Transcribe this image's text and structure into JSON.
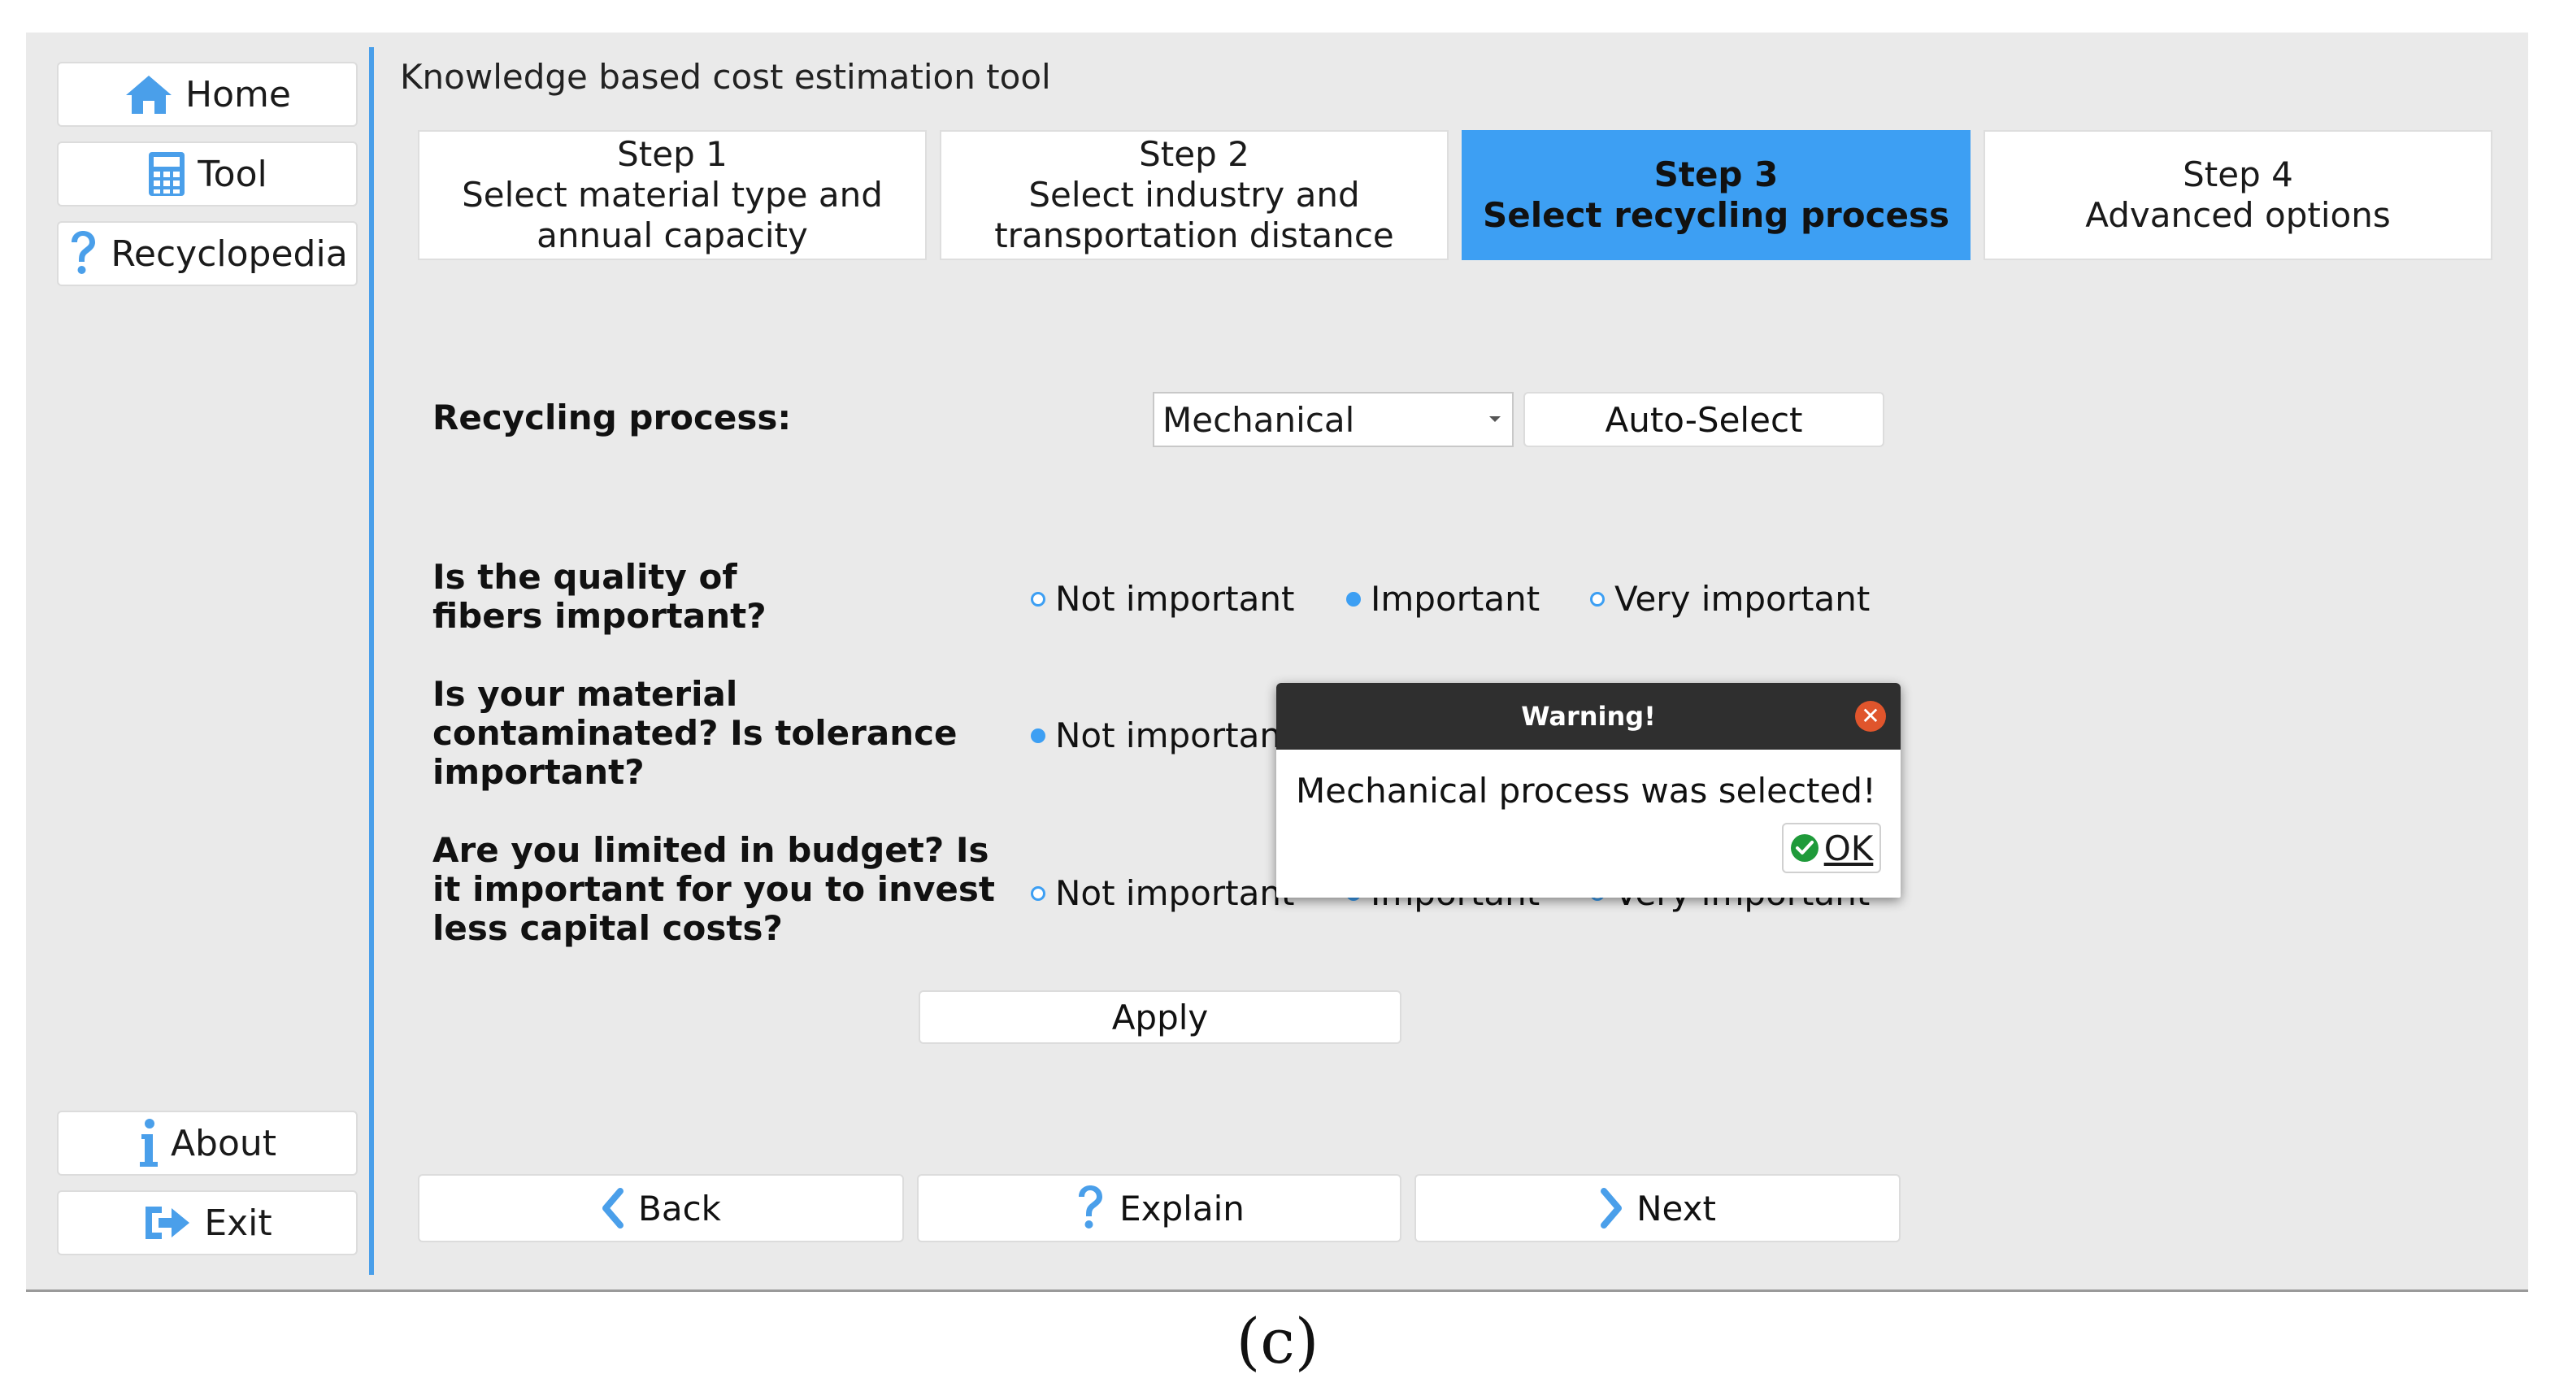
{
  "app": {
    "title": "Knowledge based cost estimation tool",
    "accent_color": "#3d9ff3"
  },
  "sidebar": {
    "items": [
      {
        "label": "Home",
        "icon": "home-icon"
      },
      {
        "label": "Tool",
        "icon": "calculator-icon"
      },
      {
        "label": "Recyclopedia",
        "icon": "question-icon"
      },
      {
        "label": "About",
        "icon": "info-icon"
      },
      {
        "label": "Exit",
        "icon": "exit-icon"
      }
    ]
  },
  "steps": [
    {
      "title": "Step 1",
      "subtitle": "Select material type and annual capacity",
      "active": false
    },
    {
      "title": "Step 2",
      "subtitle": "Select industry and transportation distance",
      "active": false
    },
    {
      "title": "Step 3",
      "subtitle": "Select recycling process",
      "active": true
    },
    {
      "title": "Step 4",
      "subtitle": "Advanced options",
      "active": false
    }
  ],
  "form": {
    "process_label": "Recycling process:",
    "process_value": "Mechanical",
    "auto_select_label": "Auto-Select",
    "questions": [
      {
        "text": "Is the quality of fibers important?",
        "selected": "Important"
      },
      {
        "text": "Is your material contaminated? Is tolerance important?",
        "selected": "Not important"
      },
      {
        "text": "Are you limited in budget? Is it important for you to invest less capital costs?",
        "selected": "Important"
      }
    ],
    "options": [
      "Not important",
      "Important",
      "Very important"
    ],
    "apply_label": "Apply"
  },
  "nav": {
    "back_label": "Back",
    "explain_label": "Explain",
    "next_label": "Next"
  },
  "dialog": {
    "title": "Warning!",
    "message": "Mechanical process was selected!",
    "ok_label": "OK"
  },
  "caption": "(c)"
}
